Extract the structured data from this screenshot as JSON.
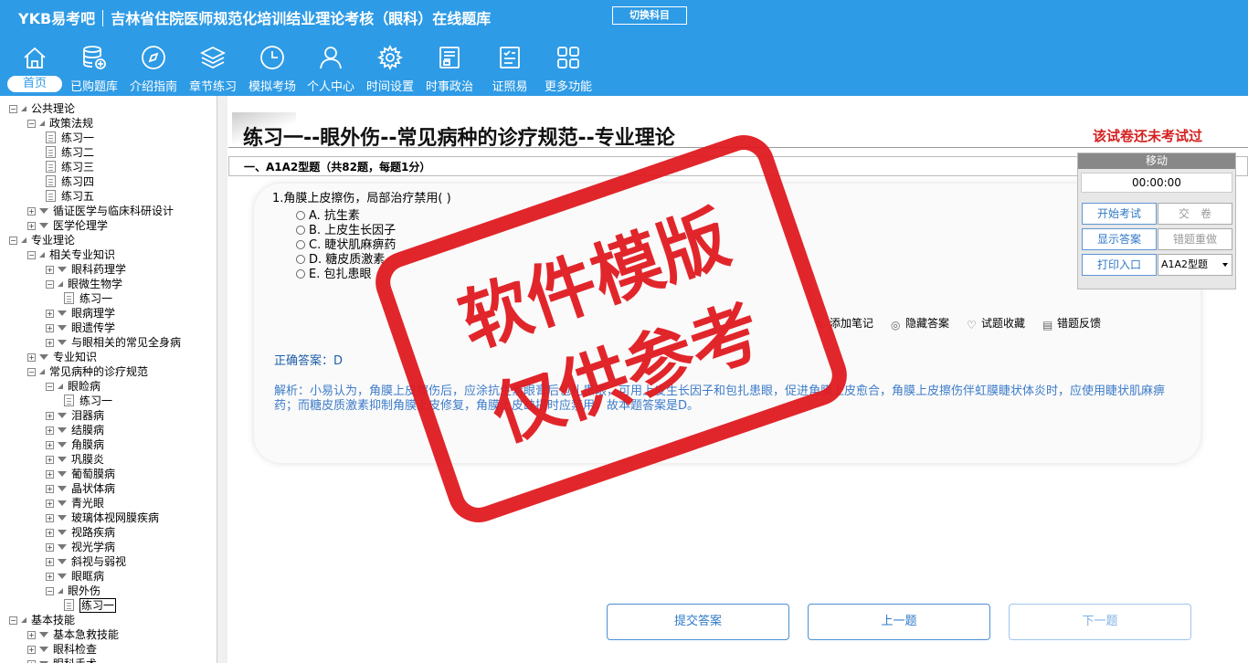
{
  "header": {
    "brand": "YKB易考吧",
    "subtitle": "吉林省住院医师规范化培训结业理论考核（眼科）在线题库",
    "switch_label": "切换科目"
  },
  "nav": [
    {
      "label": "首页",
      "icon": "home-icon"
    },
    {
      "label": "已购题库",
      "icon": "database-icon"
    },
    {
      "label": "介绍指南",
      "icon": "compass-icon"
    },
    {
      "label": "章节练习",
      "icon": "layers-icon"
    },
    {
      "label": "模拟考场",
      "icon": "clock-icon"
    },
    {
      "label": "个人中心",
      "icon": "user-icon"
    },
    {
      "label": "时间设置",
      "icon": "gear-icon"
    },
    {
      "label": "时事政治",
      "icon": "news-icon"
    },
    {
      "label": "证照易",
      "icon": "checklist-icon"
    },
    {
      "label": "更多功能",
      "icon": "grid-icon"
    }
  ],
  "tree": [
    {
      "label": "公共理论",
      "level": 0,
      "state": "open"
    },
    {
      "label": "政策法规",
      "level": 1,
      "state": "open"
    },
    {
      "label": "练习一",
      "level": 2,
      "state": "leaf"
    },
    {
      "label": "练习二",
      "level": 2,
      "state": "leaf"
    },
    {
      "label": "练习三",
      "level": 2,
      "state": "leaf"
    },
    {
      "label": "练习四",
      "level": 2,
      "state": "leaf"
    },
    {
      "label": "练习五",
      "level": 2,
      "state": "leaf"
    },
    {
      "label": "循证医学与临床科研设计",
      "level": 1,
      "state": "closed"
    },
    {
      "label": "医学伦理学",
      "level": 1,
      "state": "closed"
    },
    {
      "label": "专业理论",
      "level": 0,
      "state": "open"
    },
    {
      "label": "相关专业知识",
      "level": 1,
      "state": "open"
    },
    {
      "label": "眼科药理学",
      "level": 2,
      "state": "closed"
    },
    {
      "label": "眼微生物学",
      "level": 2,
      "state": "open"
    },
    {
      "label": "练习一",
      "level": 3,
      "state": "leaf"
    },
    {
      "label": "眼病理学",
      "level": 2,
      "state": "closed"
    },
    {
      "label": "眼遗传学",
      "level": 2,
      "state": "closed"
    },
    {
      "label": "与眼相关的常见全身病",
      "level": 2,
      "state": "closed"
    },
    {
      "label": "专业知识",
      "level": 1,
      "state": "closed"
    },
    {
      "label": "常见病种的诊疗规范",
      "level": 1,
      "state": "open"
    },
    {
      "label": "眼睑病",
      "level": 2,
      "state": "open"
    },
    {
      "label": "练习一",
      "level": 3,
      "state": "leaf"
    },
    {
      "label": "泪器病",
      "level": 2,
      "state": "closed"
    },
    {
      "label": "结膜病",
      "level": 2,
      "state": "closed"
    },
    {
      "label": "角膜病",
      "level": 2,
      "state": "closed"
    },
    {
      "label": "巩膜炎",
      "level": 2,
      "state": "closed"
    },
    {
      "label": "葡萄膜病",
      "level": 2,
      "state": "closed"
    },
    {
      "label": "晶状体病",
      "level": 2,
      "state": "closed"
    },
    {
      "label": "青光眼",
      "level": 2,
      "state": "closed"
    },
    {
      "label": "玻璃体视网膜疾病",
      "level": 2,
      "state": "closed"
    },
    {
      "label": "视路疾病",
      "level": 2,
      "state": "closed"
    },
    {
      "label": "视光学病",
      "level": 2,
      "state": "closed"
    },
    {
      "label": "斜视与弱视",
      "level": 2,
      "state": "closed"
    },
    {
      "label": "眼眶病",
      "level": 2,
      "state": "closed"
    },
    {
      "label": "眼外伤",
      "level": 2,
      "state": "open"
    },
    {
      "label": "练习一",
      "level": 3,
      "state": "leaf",
      "selected": true
    },
    {
      "label": "基本技能",
      "level": 0,
      "state": "open"
    },
    {
      "label": "基本急救技能",
      "level": 1,
      "state": "closed"
    },
    {
      "label": "眼科检查",
      "level": 1,
      "state": "closed"
    },
    {
      "label": "眼科手术",
      "level": 1,
      "state": "closed"
    }
  ],
  "main": {
    "title": "练习一--眼外伤--常见病种的诊疗规范--专业理论",
    "exam_status": "该试卷还未考试过",
    "section_header": "一、A1A2型题（共82题，每题1分）",
    "question": {
      "stem": "1.角膜上皮擦伤，局部治疗禁用( )",
      "options": [
        "A. 抗生素",
        "B. 上皮生长因子",
        "C. 睫状肌麻痹药",
        "D. 糖皮质激素",
        "E. 包扎患眼"
      ]
    },
    "tools": {
      "note": "添加笔记",
      "hide_answer": "隐藏答案",
      "favorite": "试题收藏",
      "feedback": "错题反馈"
    },
    "answer": "正确答案：D",
    "analysis": "解析：小易认为，角膜上皮擦伤后，应涂抗生素眼膏后包扎患眼，可用上皮生长因子和包扎患眼，促进角膜上皮愈合，角膜上皮擦伤伴虹膜睫状体炎时，应使用睫状肌麻痹药；而糖皮质激素抑制角膜上皮修复，角膜上皮缺损时应禁用，故本题答案是D。"
  },
  "timer": {
    "move_label": "移动",
    "time": "00:00:00",
    "start_exam": "开始考试",
    "submit_paper": "交　卷",
    "show_answer": "显示答案",
    "redo_wrong": "错题重做",
    "print": "打印入口",
    "type_value": "A1A2型题"
  },
  "bottom": {
    "submit": "提交答案",
    "prev": "上一题",
    "next": "下一题"
  },
  "watermark": {
    "line1": "软件模版",
    "line2": "仅供参考"
  },
  "colors": {
    "header_bg": "#2e9be6",
    "accent_blue": "#2f79c7",
    "status_red": "#d42020",
    "stamp_red": "#e0191f"
  }
}
